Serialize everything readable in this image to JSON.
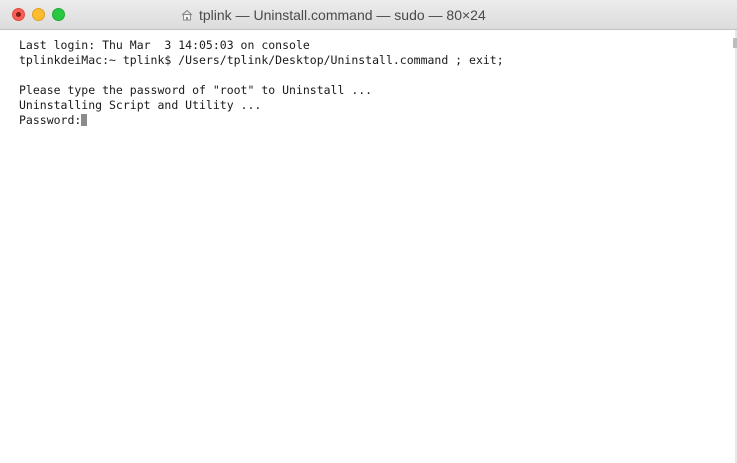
{
  "window": {
    "title": "tplink — Uninstall.command — sudo — 80×24",
    "title_icon": "home-folder-icon"
  },
  "terminal": {
    "lines": [
      "Last login: Thu Mar  3 14:05:03 on console",
      "tplinkdeiMac:~ tplink$ /Users/tplink/Desktop/Uninstall.command ; exit;",
      "",
      "Please type the password of \"root\" to Uninstall ...",
      "Uninstalling Script and Utility ...",
      "Password:"
    ]
  },
  "colors": {
    "close": "#fc5f57",
    "minimize": "#fdbc2e",
    "maximize": "#28c840",
    "text": "#1a1a1a",
    "cursor": "#8c8c8c"
  }
}
